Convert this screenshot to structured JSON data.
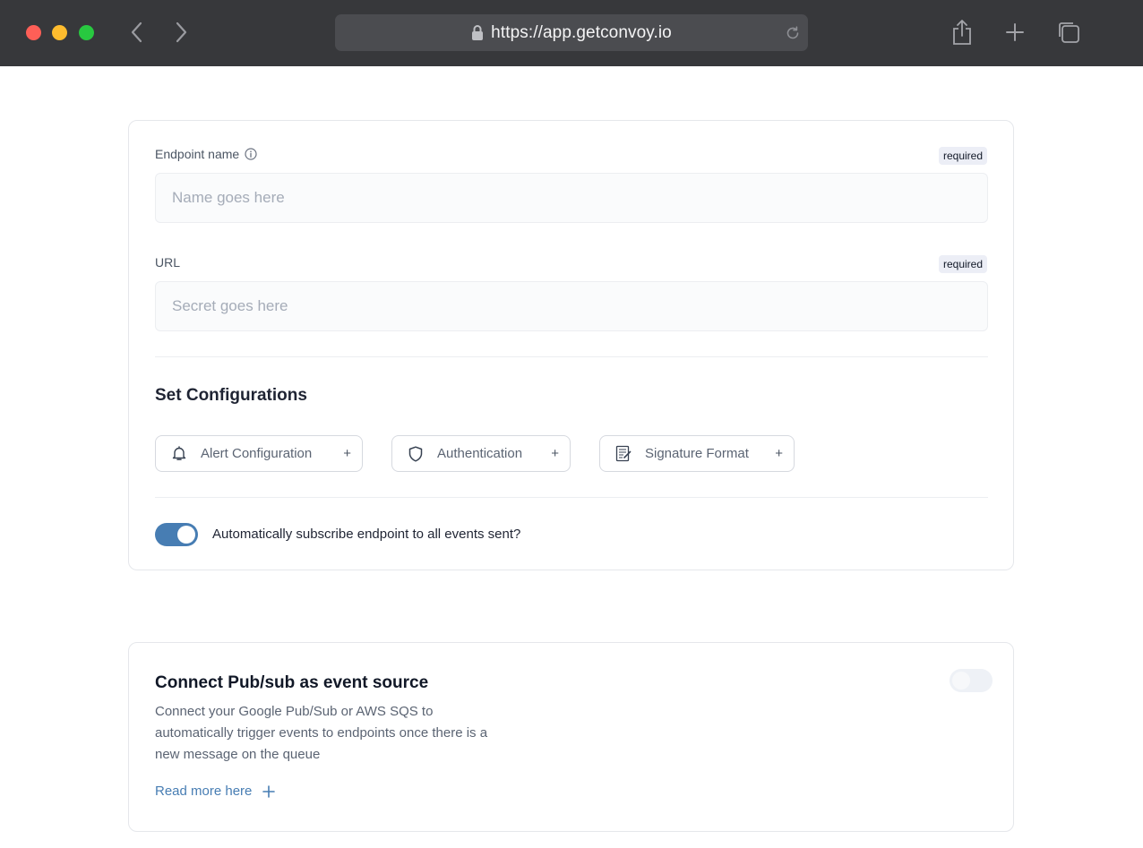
{
  "browser": {
    "url": "https://app.getconvoy.io",
    "colors": {
      "chrome": "#37383b",
      "urlbar": "#4b4c50"
    }
  },
  "endpoint_form": {
    "name_label": "Endpoint name",
    "name_badge": "required",
    "name_placeholder": "Name goes here",
    "url_label": "URL",
    "url_badge": "required",
    "url_placeholder": "Secret goes here",
    "config_title": "Set Configurations",
    "config_buttons": [
      {
        "label": "Alert Configuration",
        "icon": "bell-icon"
      },
      {
        "label": "Authentication",
        "icon": "shield-icon"
      },
      {
        "label": "Signature Format",
        "icon": "document-icon"
      }
    ],
    "subscribe_toggle_on": true,
    "subscribe_label": "Automatically subscribe endpoint to all events sent?"
  },
  "pubsub": {
    "title": "Connect Pub/sub as event source",
    "description": "Connect your Google Pub/Sub or AWS SQS to automatically trigger events to endpoints once there is a new message on the queue",
    "read_more": "Read more here",
    "toggle_on": false
  },
  "colors": {
    "accent": "#477db3",
    "badge_bg": "#eceef6"
  }
}
